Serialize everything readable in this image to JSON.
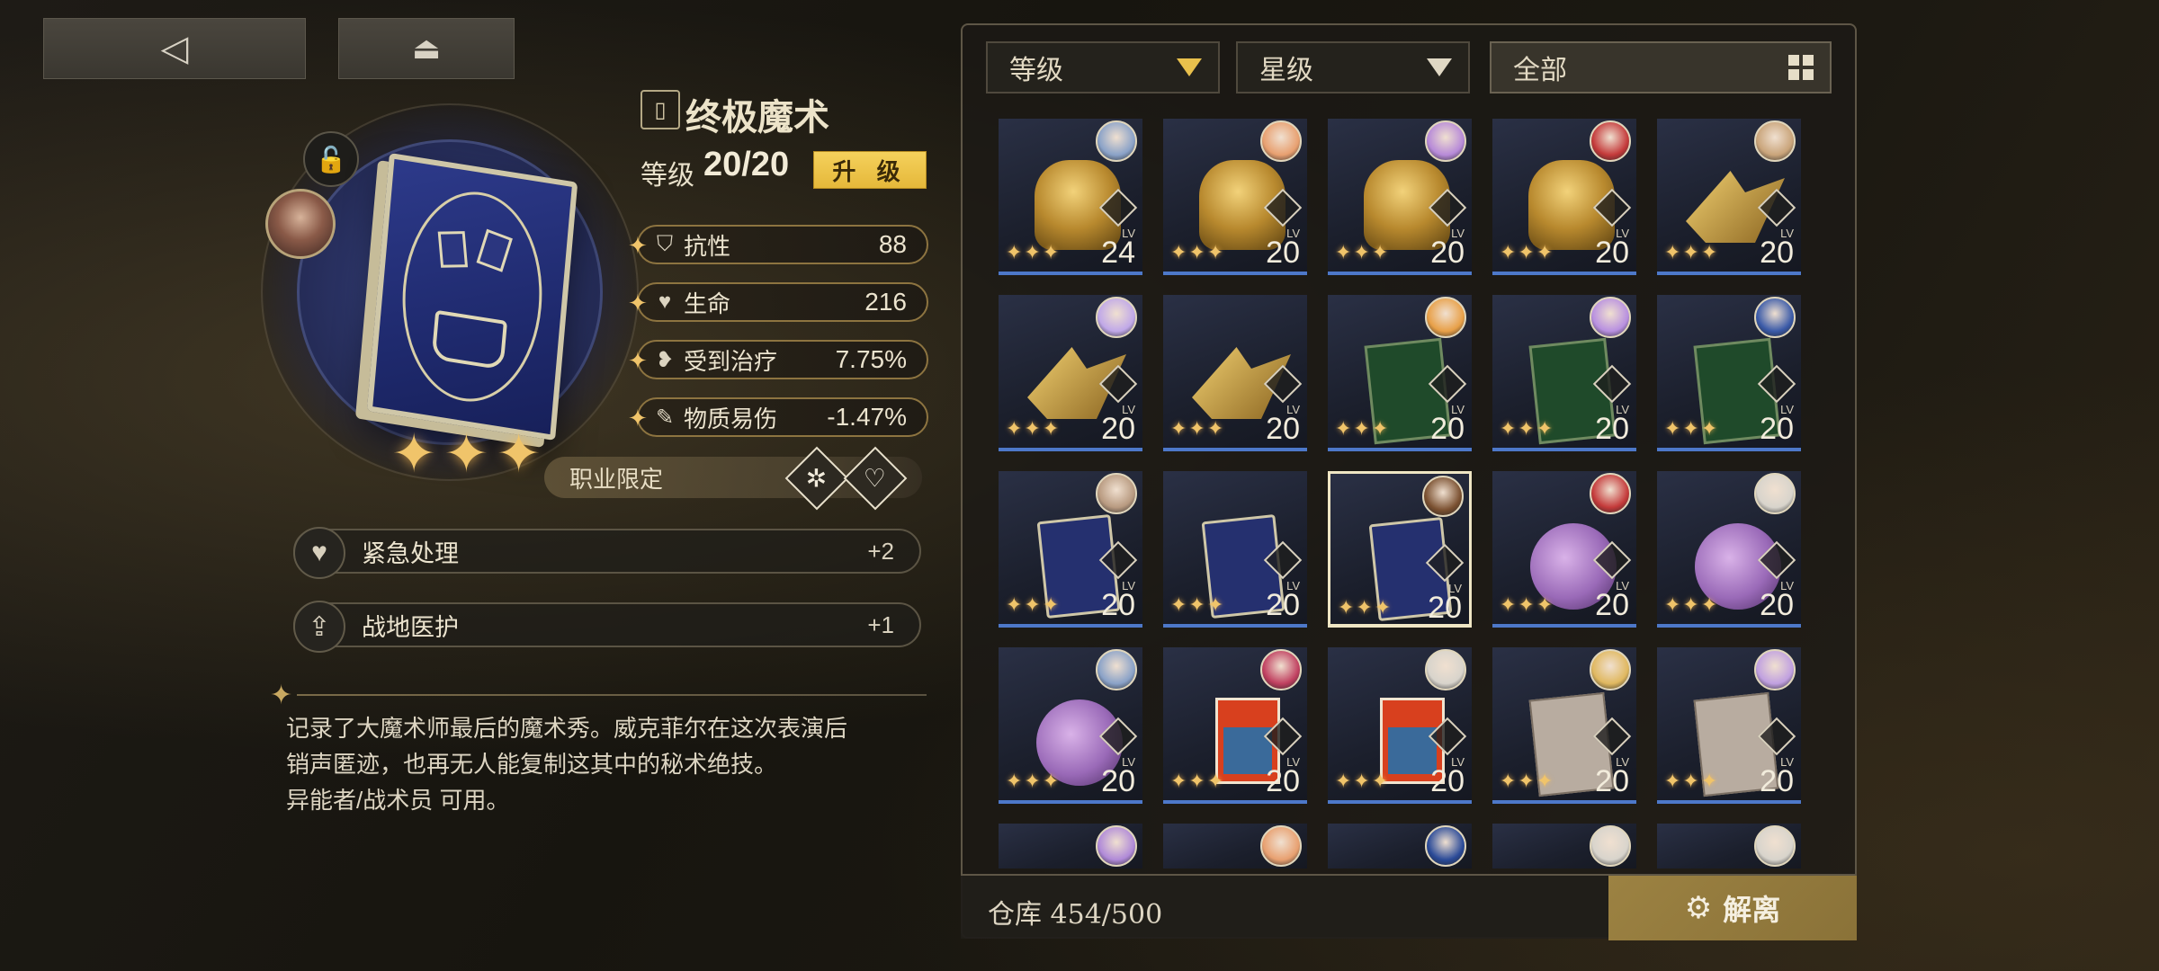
{
  "nav": {
    "back_icon": "back-arrow-icon",
    "menu_icon": "home-menu-icon"
  },
  "item": {
    "name": "终极魔术",
    "level_label": "等级",
    "level_value": "20/20",
    "upgrade_label": "升 级",
    "rarity_stars": 3
  },
  "stats": [
    {
      "icon": "shield-icon",
      "label": "抗性",
      "value": "88"
    },
    {
      "icon": "heart-icon",
      "label": "生命",
      "value": "216"
    },
    {
      "icon": "heal-heart-icon",
      "label": "受到治疗",
      "value": "7.75%"
    },
    {
      "icon": "syringe-icon",
      "label": "物质易伤",
      "value": "-1.47%"
    }
  ],
  "class_restriction": {
    "label": "职业限定",
    "icons": [
      "esper-class-icon",
      "combatant-class-icon"
    ]
  },
  "skills": [
    {
      "icon": "first-aid-icon",
      "label": "紧急处理",
      "bonus": "+2"
    },
    {
      "icon": "field-medic-icon",
      "label": "战地医护",
      "bonus": "+1"
    }
  ],
  "description": {
    "line1": "记录了大魔术师最后的魔术秀。威克菲尔在这次表演后",
    "line2": "销声匿迹，也再无人能复制这其中的秘术绝技。",
    "line3": "异能者/战术员 可用。"
  },
  "filters": {
    "level": "等级",
    "star": "星级",
    "all": "全部"
  },
  "inventory": [
    {
      "type": "lion",
      "level": "24",
      "avatar": "#8aa2c8"
    },
    {
      "type": "lion",
      "level": "20",
      "avatar": "#e8a070"
    },
    {
      "type": "lion",
      "level": "20",
      "avatar": "#b78ad8"
    },
    {
      "type": "lion",
      "level": "20",
      "avatar": "#c43a3a"
    },
    {
      "type": "wings",
      "level": "20",
      "avatar": "#c9a47a"
    },
    {
      "type": "wings",
      "level": "20",
      "avatar": "#c0a8e8"
    },
    {
      "type": "wings",
      "level": "20",
      "avatar": ""
    },
    {
      "type": "green-book",
      "level": "20",
      "avatar": "#e8a048"
    },
    {
      "type": "green-book",
      "level": "20",
      "avatar": "#b890e0"
    },
    {
      "type": "green-book",
      "level": "20",
      "avatar": "#3a5aa8"
    },
    {
      "type": "magic-book",
      "level": "20",
      "avatar": "#b89a80"
    },
    {
      "type": "magic-book",
      "level": "20",
      "avatar": ""
    },
    {
      "type": "magic-book",
      "level": "20",
      "avatar": "#7a5030",
      "selected": true
    },
    {
      "type": "octopus",
      "level": "20",
      "avatar": "#c43a3a"
    },
    {
      "type": "octopus",
      "level": "20",
      "avatar": "#d8d4cc"
    },
    {
      "type": "octopus",
      "level": "20",
      "avatar": "#8aa2c8"
    },
    {
      "type": "magazine",
      "level": "20",
      "avatar": "#c04060"
    },
    {
      "type": "magazine",
      "level": "20",
      "avatar": "#d8d4cc"
    },
    {
      "type": "tentacle",
      "level": "20",
      "avatar": "#e0b860"
    },
    {
      "type": "tentacle",
      "level": "20",
      "avatar": "#c0a0e0"
    }
  ],
  "inventory_partial": [
    {
      "avatar": "#b08ad8"
    },
    {
      "avatar": "#e8a070"
    },
    {
      "avatar": "#2a4a98"
    },
    {
      "avatar": "#d8d4cc"
    },
    {
      "avatar": "#d8d4cc"
    }
  ],
  "card_lv_label": "LV",
  "storage": {
    "label": "仓库 454/500"
  },
  "dismantle_label": "解离",
  "colors": {
    "accent_gold": "#f0c46a",
    "upgrade_btn": "#f2c94c",
    "card_bar_blue": "#4d78c9",
    "dismantle_btn": "#9c8242"
  }
}
